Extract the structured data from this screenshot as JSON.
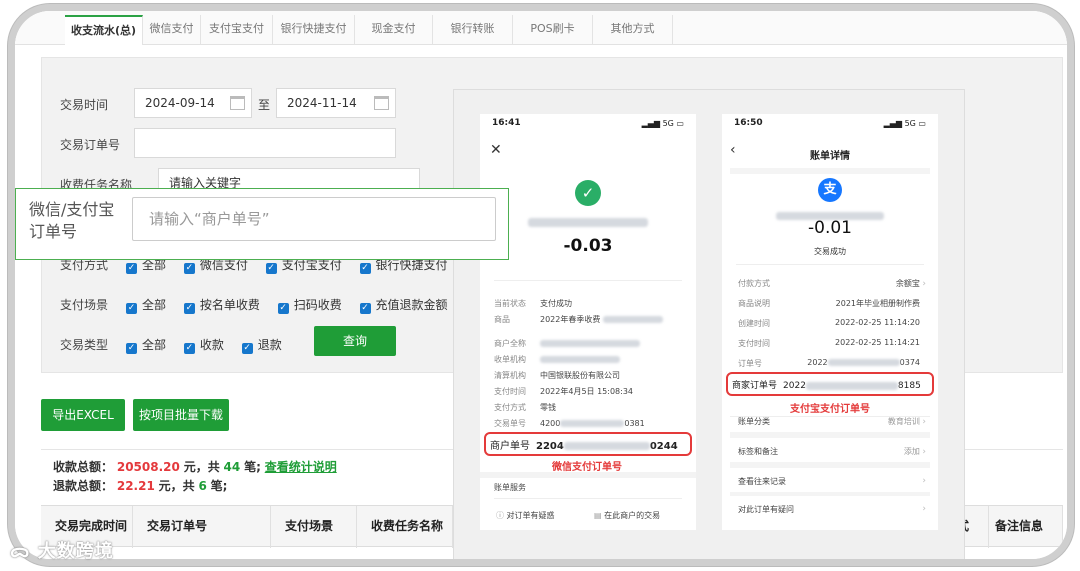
{
  "tabs": [
    {
      "label": "收支流水(总)",
      "active": true
    },
    {
      "label": "微信支付"
    },
    {
      "label": "支付宝支付"
    },
    {
      "label": "银行快捷支付"
    },
    {
      "label": "现金支付"
    },
    {
      "label": "银行转账"
    },
    {
      "label": "POS刷卡"
    },
    {
      "label": "其他方式"
    }
  ],
  "filters": {
    "trade_time_label": "交易时间",
    "date_from": "2024-09-14",
    "date_sep": "至",
    "date_to": "2024-11-14",
    "order_no_label": "交易订单号",
    "order_no_value": "",
    "task_name_label": "收费任务名称",
    "task_name_placeholder": "请输入关键字",
    "pay_method_label": "支付方式",
    "pay_methods": [
      "全部",
      "微信支付",
      "支付宝支付",
      "银行快捷支付"
    ],
    "scene_label": "支付场景",
    "scenes": [
      "全部",
      "按名单收费",
      "扫码收费",
      "充值退款金额"
    ],
    "type_label": "交易类型",
    "types": [
      "全部",
      "收款",
      "退款"
    ],
    "query_button": "查询"
  },
  "callout": {
    "label": "微信/支付宝订单号",
    "placeholder": "请输入“商户单号”"
  },
  "actions": {
    "export_excel": "导出EXCEL",
    "batch_download": "按项目批量下载"
  },
  "summary": {
    "income_label": "收款总额：",
    "income_amount": "20508.20",
    "income_unit": "元，共",
    "income_count": "44",
    "income_count_unit": "笔;",
    "stats_link": "查看统计说明",
    "refund_label": "退款总额：",
    "refund_amount": "22.21",
    "refund_unit": "元，共",
    "refund_count": "6",
    "refund_count_unit": "笔;"
  },
  "table_headers": [
    "交易完成时间",
    "交易订单号",
    "支付场景",
    "收费任务名称",
    "付方式",
    "备注信息"
  ],
  "wechat_receipt": {
    "time": "16:41",
    "signal": "5G",
    "close_icon": "close-icon",
    "amount": "-0.03",
    "rows": [
      {
        "k": "当前状态",
        "v": "支付成功"
      },
      {
        "k": "商品",
        "v": "2022年春季收费"
      },
      {
        "k": "商户全称",
        "v": ""
      },
      {
        "k": "收单机构",
        "v": ""
      },
      {
        "k": "清算机构",
        "v": "中国银联股份有限公司"
      },
      {
        "k": "支付时间",
        "v": "2022年4月5日 15:08:34"
      },
      {
        "k": "支付方式",
        "v": "零钱"
      },
      {
        "k": "交易单号",
        "v": "4200",
        "v2": "0381"
      }
    ],
    "merchant_no_label": "商户单号",
    "merchant_no_start": "2204",
    "merchant_no_end": "0244",
    "highlight_caption": "微信支付订单号",
    "bill_service": "账单服务",
    "doubt_link": "对订单有疑惑",
    "merchant_trade_link": "在此商户的交易"
  },
  "alipay_receipt": {
    "time": "16:50",
    "signal": "5G",
    "back_icon": "back-arrow-icon",
    "title": "账单详情",
    "amount": "-0.01",
    "status": "交易成功",
    "rows": [
      {
        "k": "付款方式",
        "v": "余额宝"
      },
      {
        "k": "商品说明",
        "v": "2021年毕业相册制作费"
      },
      {
        "k": "创建时间",
        "v": "2022-02-25 11:14:20"
      },
      {
        "k": "支付时间",
        "v": "2022-02-25 11:14:21"
      },
      {
        "k": "订单号",
        "v": "2022",
        "v2": "0374"
      }
    ],
    "merchant_no_label": "商家订单号",
    "merchant_no_start": "2022",
    "merchant_no_end": "8185",
    "highlight_caption": "支付宝支付订单号",
    "menu": [
      {
        "k": "账单分类",
        "v": "教育培训"
      },
      {
        "k": "标签和备注",
        "v": "添加"
      },
      {
        "k": "查看往来记录",
        "v": ""
      },
      {
        "k": "对此订单有疑问",
        "v": ""
      }
    ]
  },
  "watermark": "大数跨境",
  "colors": {
    "green": "#1f9d37",
    "red": "#e43a3a",
    "alipay_blue": "#1677ff",
    "wechat_green": "#2aae67"
  }
}
